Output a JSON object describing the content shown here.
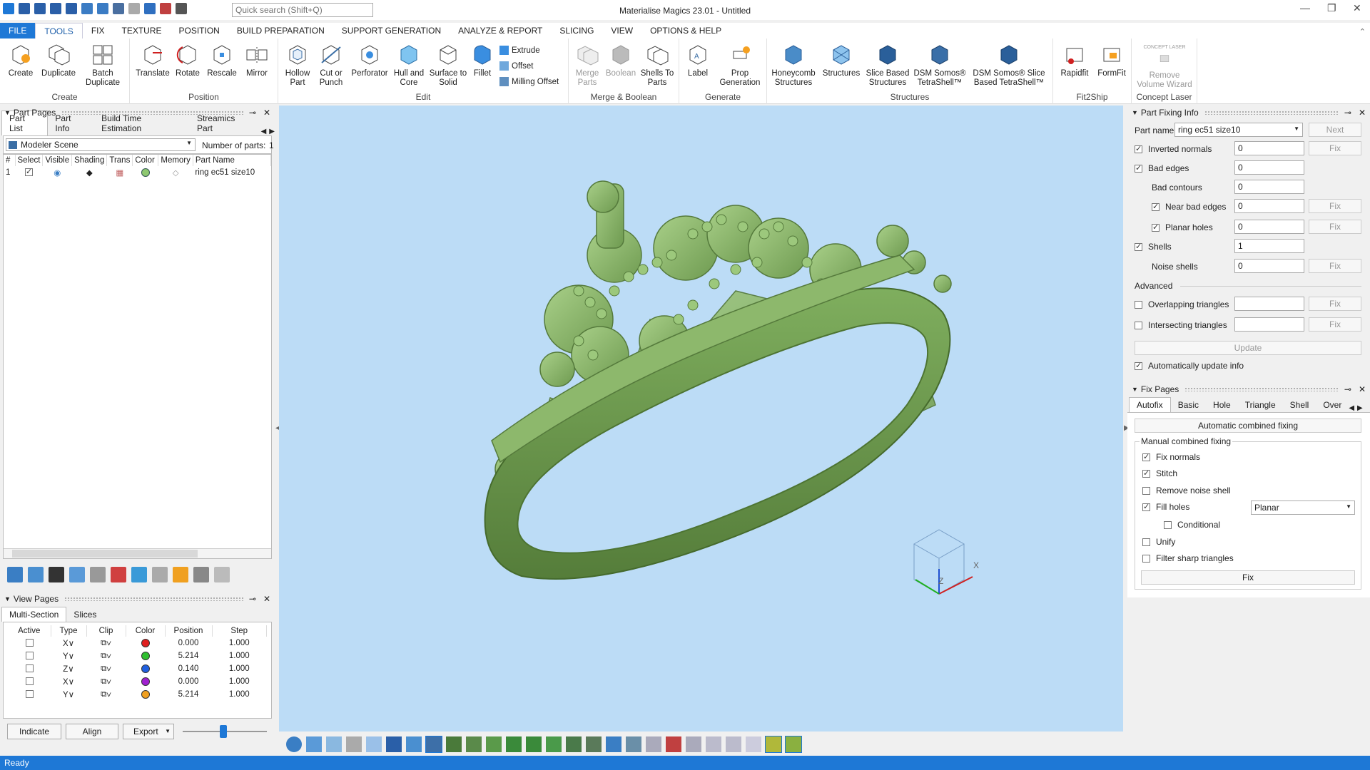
{
  "app": {
    "title": "Materialise Magics 23.01 - Untitled",
    "search_placeholder": "Quick search (Shift+Q)"
  },
  "menu": [
    "FILE",
    "TOOLS",
    "FIX",
    "TEXTURE",
    "POSITION",
    "BUILD PREPARATION",
    "SUPPORT GENERATION",
    "ANALYZE & REPORT",
    "SLICING",
    "VIEW",
    "OPTIONS & HELP"
  ],
  "ribbon": {
    "groups": {
      "create": "Create",
      "position": "Position",
      "edit": "Edit",
      "merge": "Merge & Boolean",
      "generate": "Generate",
      "structures": "Structures",
      "fit2ship": "Fit2Ship",
      "concept": "Concept Laser"
    },
    "create": [
      "Create",
      "Duplicate",
      "Batch Duplicate"
    ],
    "position": [
      "Translate",
      "Rotate",
      "Rescale",
      "Mirror"
    ],
    "edit": [
      "Hollow Part",
      "Cut or Punch",
      "Perforator",
      "Hull and Core",
      "Surface to Solid",
      "Fillet"
    ],
    "edit_small": [
      "Extrude",
      "Offset",
      "Milling Offset"
    ],
    "merge": [
      "Merge Parts",
      "Boolean",
      "Shells To Parts"
    ],
    "generate": [
      "Label",
      "Prop Generation"
    ],
    "structures": [
      "Honeycomb Structures",
      "Structures",
      "Slice Based Structures",
      "DSM Somos® TetraShell™",
      "DSM Somos® Slice Based TetraShell™"
    ],
    "fit2ship": [
      "Rapidfit",
      "FormFit"
    ],
    "concept": [
      "Remove Volume Wizard"
    ],
    "concept_logo": "CONCEPT LASER"
  },
  "part_pages": {
    "title": "Part Pages",
    "tabs": [
      "Part List",
      "Part Info",
      "Build Time Estimation",
      "Streamics Part"
    ],
    "scene": "Modeler Scene",
    "count_label": "Number of parts:",
    "count": "1",
    "columns": [
      "#",
      "Select",
      "Visible",
      "Shading",
      "Trans",
      "Color",
      "Memory",
      "Part Name"
    ],
    "rows": [
      {
        "n": "1",
        "name": "ring ec51 size10"
      }
    ]
  },
  "view_pages": {
    "title": "View Pages",
    "tabs": [
      "Multi-Section",
      "Slices"
    ],
    "columns": [
      "Active",
      "Type",
      "Clip",
      "Color",
      "Position",
      "Step"
    ],
    "rows": [
      {
        "type": "X",
        "color": "#e02020",
        "position": "0.000",
        "step": "1.000"
      },
      {
        "type": "Y",
        "color": "#2fbf2f",
        "position": "5.214",
        "step": "1.000"
      },
      {
        "type": "Z",
        "color": "#2060e0",
        "position": "0.140",
        "step": "1.000"
      },
      {
        "type": "X",
        "color": "#a020d0",
        "position": "0.000",
        "step": "1.000"
      },
      {
        "type": "Y",
        "color": "#f0a020",
        "position": "5.214",
        "step": "1.000"
      }
    ],
    "buttons": [
      "Indicate",
      "Align",
      "Export"
    ]
  },
  "fix_info": {
    "title": "Part Fixing Info",
    "part_name_label": "Part name",
    "part_name": "ring ec51 size10",
    "next": "Next",
    "fix": "Fix",
    "rows": [
      {
        "label": "Inverted normals",
        "value": "0"
      },
      {
        "label": "Bad edges",
        "value": "0"
      },
      {
        "label": "Bad contours",
        "value": "0"
      },
      {
        "label": "Near bad edges",
        "value": "0"
      },
      {
        "label": "Planar holes",
        "value": "0"
      },
      {
        "label": "Shells",
        "value": "1"
      },
      {
        "label": "Noise shells",
        "value": "0"
      }
    ],
    "advanced": "Advanced",
    "overlapping": "Overlapping triangles",
    "intersecting": "Intersecting triangles",
    "update": "Update",
    "auto_update": "Automatically update info"
  },
  "fix_pages": {
    "title": "Fix Pages",
    "tabs": [
      "Autofix",
      "Basic",
      "Hole",
      "Triangle",
      "Shell",
      "Over"
    ],
    "auto_combined": "Automatic combined fixing",
    "manual_label": "Manual combined fixing",
    "options": [
      "Fix normals",
      "Stitch",
      "Remove noise shell",
      "Fill holes",
      "Conditional",
      "Unify",
      "Filter sharp triangles"
    ],
    "fill_mode": "Planar",
    "fix": "Fix"
  },
  "status": "Ready",
  "axis": {
    "x": "X",
    "z": "Z"
  }
}
